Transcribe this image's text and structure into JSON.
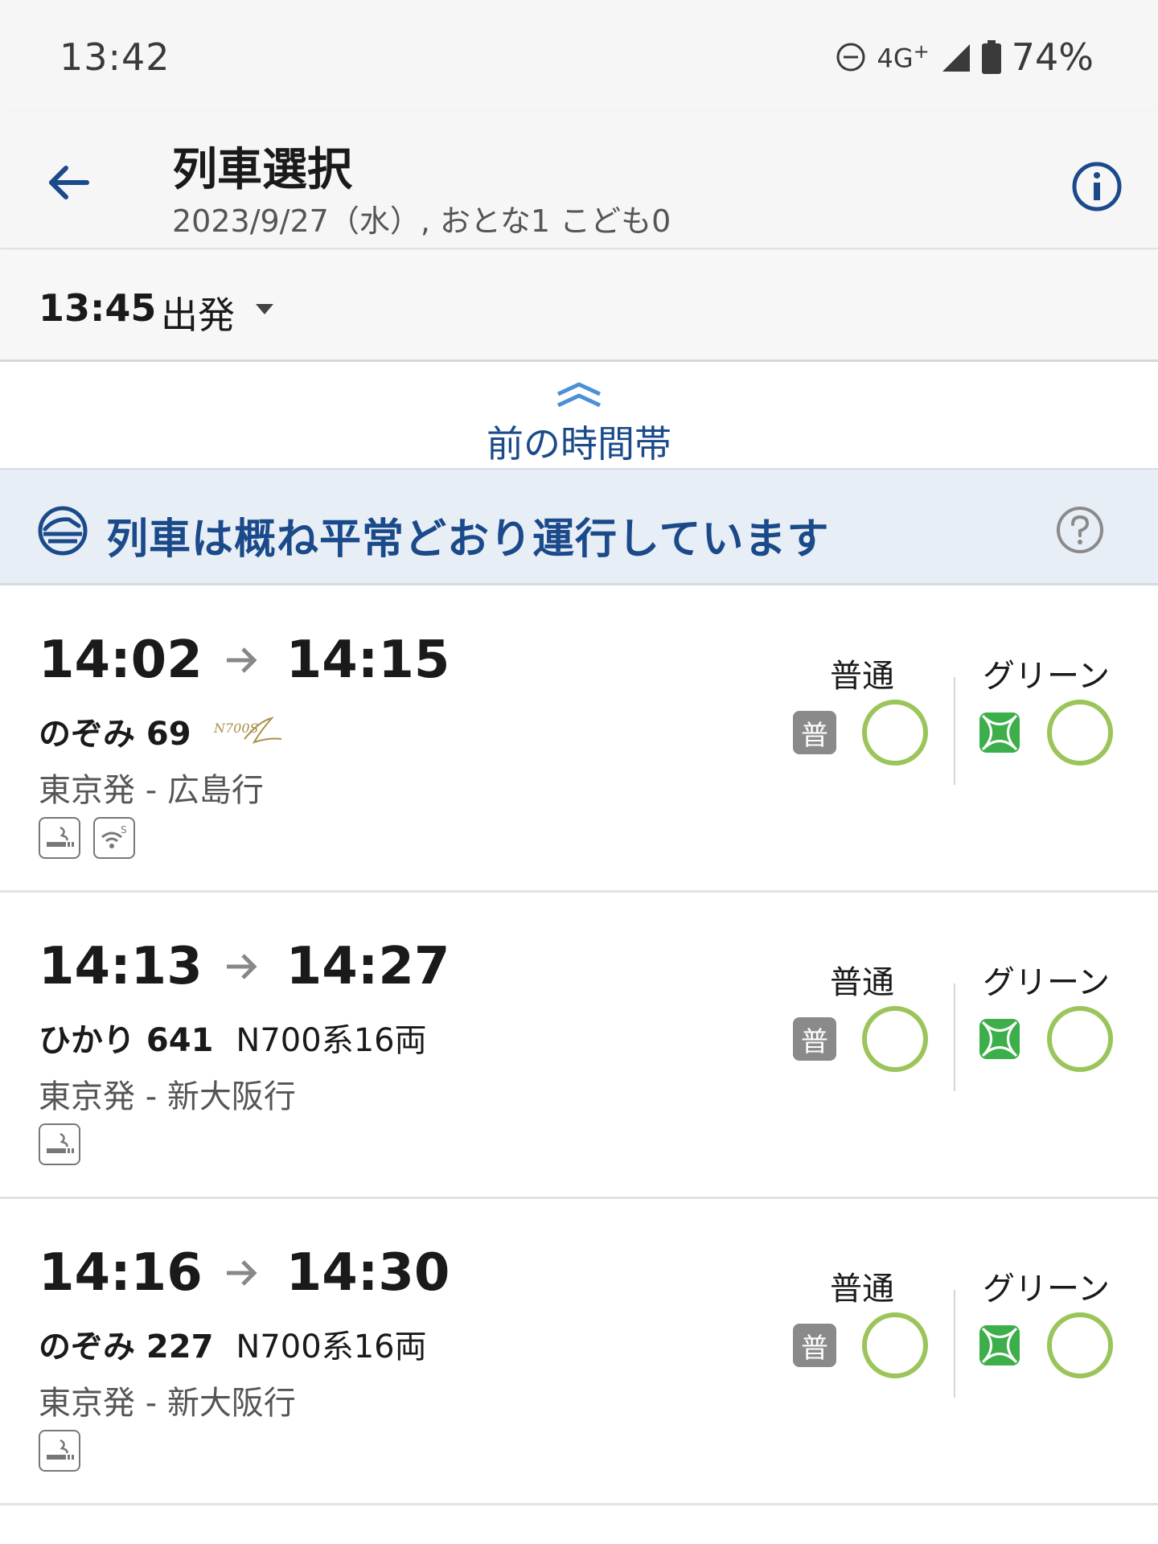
{
  "status_bar": {
    "time": "13:42",
    "network": "4G",
    "network_plus": "+",
    "battery": "74%",
    "icons": [
      "do-not-disturb-icon",
      "signal-icon",
      "battery-icon"
    ]
  },
  "app_bar": {
    "title": "列車選択",
    "subtitle": "2023/9/27（水）, おとな1 こども0",
    "icons": [
      "back-arrow-icon",
      "info-icon"
    ]
  },
  "departure": {
    "time": "13:45",
    "label": "出発"
  },
  "previous": {
    "label": "前の時間帯"
  },
  "notice": {
    "message": "列車は概ね平常どおり運行しています",
    "icons": [
      "train-status-icon",
      "help-icon"
    ]
  },
  "classes": {
    "futsu": "普通",
    "green": "グリーン",
    "futsu_badge": "普"
  },
  "colors": {
    "accent_blue": "#1b4a8a",
    "available_green": "#9bc55a",
    "green_car": "#3cae4a"
  },
  "trains": [
    {
      "depart": "14:02",
      "arrive": "14:15",
      "name": "のぞみ 69",
      "type": "",
      "logo": "N700S",
      "route": "東京発 - 広島行",
      "amenities": [
        "smoking-room-icon",
        "wifi-icon"
      ],
      "futsu_available": true,
      "green_available": true
    },
    {
      "depart": "14:13",
      "arrive": "14:27",
      "name": "ひかり 641",
      "type": "N700系16両",
      "route": "東京発 - 新大阪行",
      "amenities": [
        "smoking-room-icon"
      ],
      "futsu_available": true,
      "green_available": true
    },
    {
      "depart": "14:16",
      "arrive": "14:30",
      "name": "のぞみ 227",
      "type": "N700系16両",
      "route": "東京発 - 新大阪行",
      "amenities": [
        "smoking-room-icon"
      ],
      "futsu_available": true,
      "green_available": true
    }
  ]
}
